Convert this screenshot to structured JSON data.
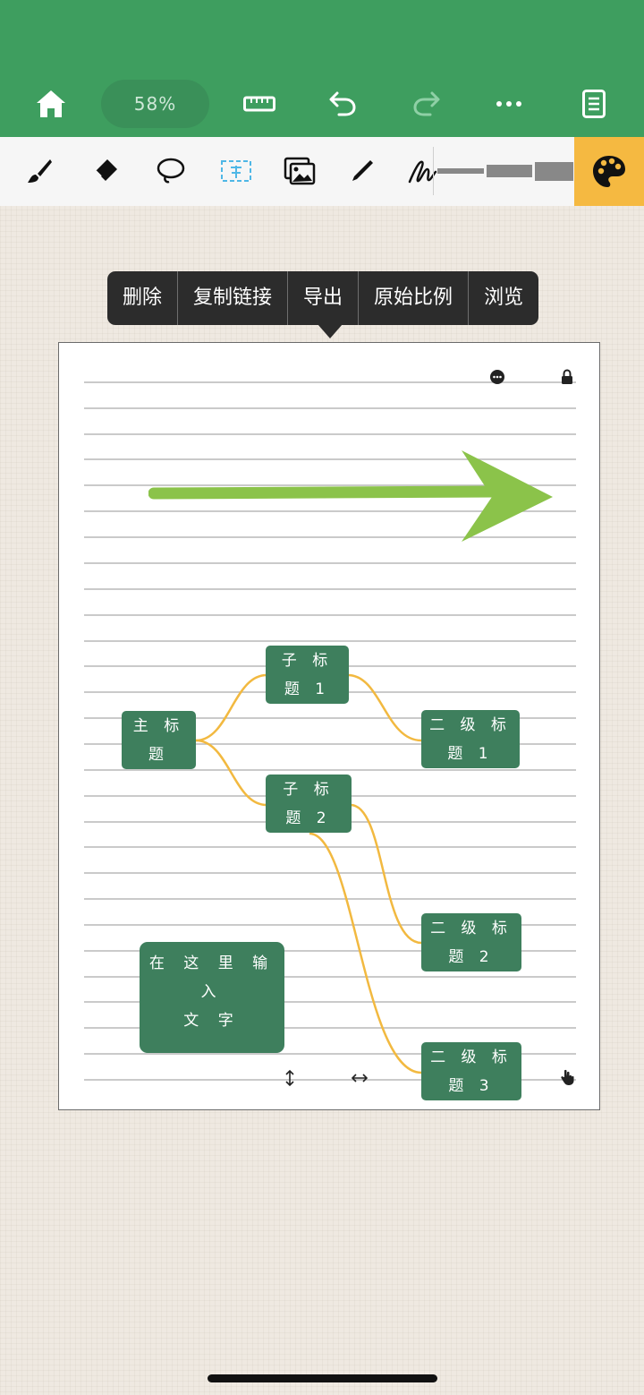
{
  "topbar": {
    "zoom_label": "58%",
    "icons": [
      "home-icon",
      "ruler-icon",
      "undo-icon",
      "redo-icon",
      "more-icon",
      "document-icon"
    ],
    "background": "#3e9e5f"
  },
  "toolbar": {
    "tools": [
      "brush-icon",
      "eraser-icon",
      "lasso-icon",
      "text-box-icon",
      "image-icon",
      "pencil-icon",
      "signature-icon"
    ],
    "stroke_sizes": [
      "thin",
      "medium",
      "thick"
    ],
    "palette_color": "#f5b941"
  },
  "context_menu": {
    "items": [
      "删除",
      "复制链接",
      "导出",
      "原始比例",
      "浏览"
    ]
  },
  "mindmap": {
    "root": [
      "主 标",
      "题"
    ],
    "sub1": [
      "子 标",
      "题 1"
    ],
    "sub2": [
      "子 标",
      "题 2"
    ],
    "level2_1": [
      "二 级 标",
      "题 1"
    ],
    "level2_2": [
      "二 级 标",
      "题 2"
    ],
    "level2_3": [
      "二 级 标",
      "题 3"
    ],
    "node_color": "#3e7f5d",
    "link_color": "#f2b940"
  },
  "free_text": [
    "在 这 里 输 入",
    "文 字"
  ],
  "arrow_color": "#8bc34a"
}
